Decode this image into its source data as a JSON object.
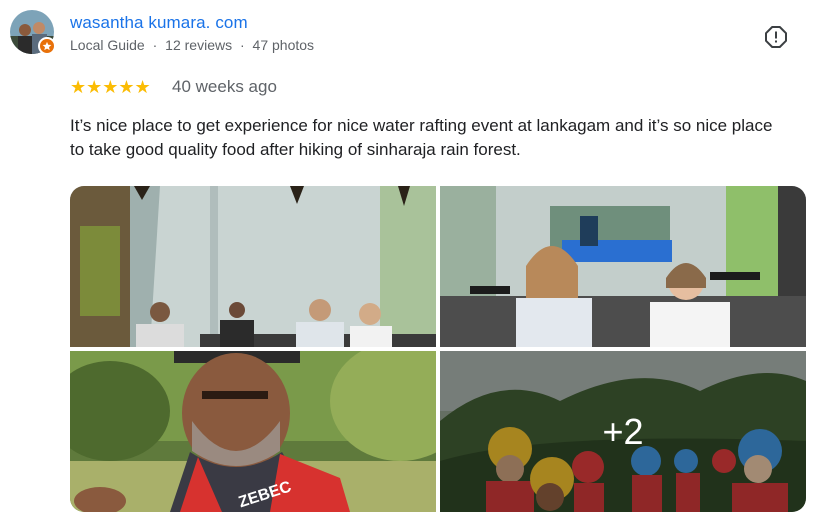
{
  "reviewer": {
    "name": "wasantha kumara. com",
    "role": "Local Guide",
    "separator": "·",
    "reviews": "12 reviews",
    "photos": "47 photos"
  },
  "review": {
    "rating": 5,
    "stars": "★★★★★",
    "time": "40 weeks ago",
    "text": "It’s nice place to get experience for nice water rafting event at lankagam and it’s so nice place to take good quality food after hiking of sinharaja rain forest."
  },
  "photos": {
    "more_count": "+2",
    "jacket_text": "ZEBEC"
  },
  "icons": {
    "report": "report-flag-icon",
    "badge": "local-guide-star-icon"
  },
  "colors": {
    "link": "#1a73e8",
    "star": "#fbbc04",
    "badge": "#e8710a",
    "meta": "#5f6368"
  }
}
